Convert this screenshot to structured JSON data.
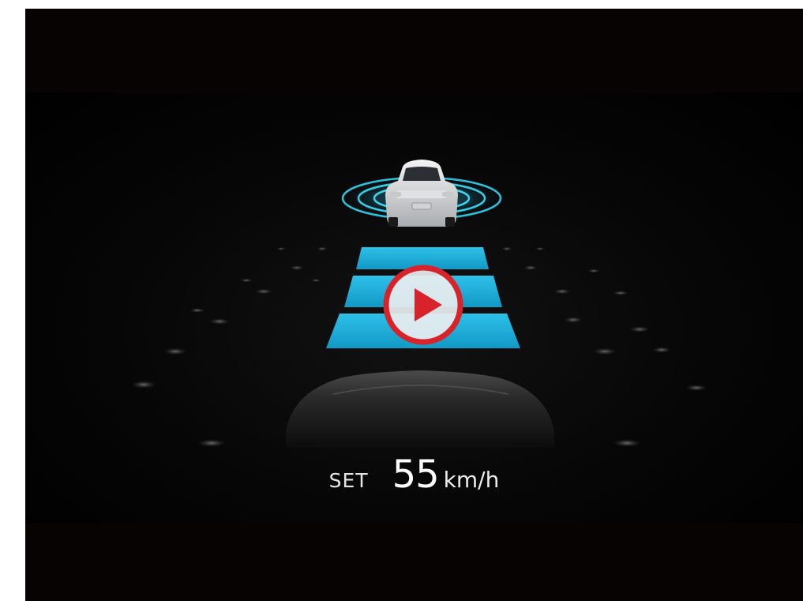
{
  "video": {
    "set_label": "SET",
    "speed_value": "55",
    "speed_unit": "km/h",
    "play_icon": "play-icon",
    "colors": {
      "lane_blue": "#1fb3de",
      "radar_cyan": "#2bc4e0",
      "play_red": "#d8232a",
      "background": "#080303"
    }
  }
}
